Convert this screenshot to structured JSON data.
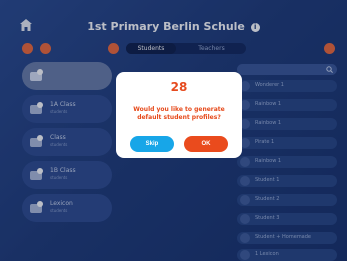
{
  "header": {
    "school_name": "1st Primary Berlin Schule"
  },
  "tabs": [
    {
      "label": "Students",
      "active": true
    },
    {
      "label": "Teachers",
      "active": false
    }
  ],
  "classes": [
    {
      "name": "",
      "subtitle": "",
      "selected": true
    },
    {
      "name": "1A Class",
      "subtitle": "students",
      "selected": false
    },
    {
      "name": "Class",
      "subtitle": "students",
      "selected": false
    },
    {
      "name": "1B Class",
      "subtitle": "students",
      "selected": false
    },
    {
      "name": "Lexicon",
      "subtitle": "students",
      "selected": false
    }
  ],
  "students": [
    "Wonderer 1",
    "Rainbow 1",
    "Rainbow 1",
    "Pirate 1",
    "Rainbow 1",
    "Student 1",
    "Student 2",
    "Student 3",
    "Student + Homemade",
    "1 Lexicon"
  ],
  "dialog": {
    "count": "28",
    "message": "Would you like to generate default student profiles?",
    "skip_label": "Skip",
    "ok_label": "OK"
  },
  "colors": {
    "background": "#1f3b78",
    "accent_orange": "#ea4b1d",
    "skip_blue": "#17a6e8"
  }
}
